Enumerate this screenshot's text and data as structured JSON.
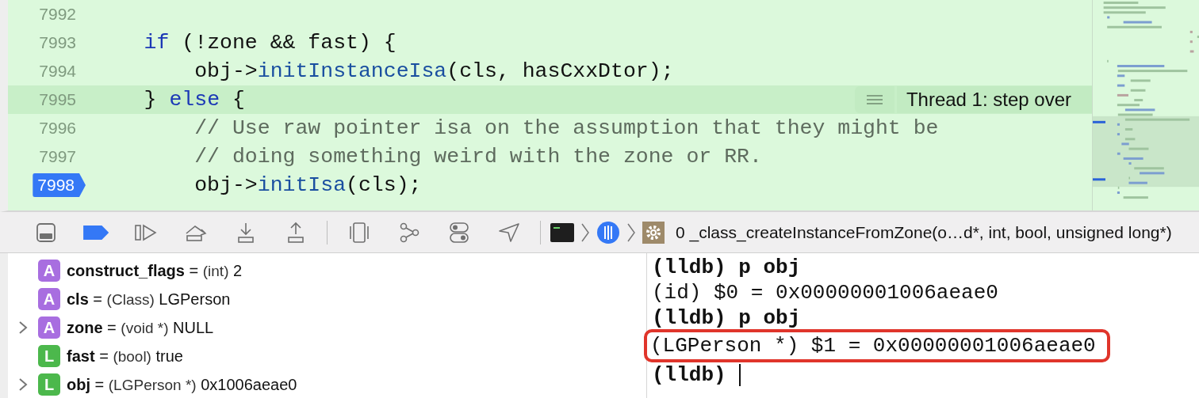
{
  "editor": {
    "lines": [
      {
        "number": "7992",
        "current": false,
        "breakpoint": false
      },
      {
        "number": "7993",
        "current": false,
        "breakpoint": false,
        "tokens": [
          {
            "kind": "keyword",
            "text": "    if"
          },
          {
            "kind": "plain",
            "text": " (!zone && fast) {"
          }
        ]
      },
      {
        "number": "7994",
        "current": false,
        "breakpoint": false,
        "tokens": [
          {
            "kind": "plain",
            "text": "        obj->"
          },
          {
            "kind": "method",
            "text": "initInstanceIsa"
          },
          {
            "kind": "plain",
            "text": "(cls, hasCxxDtor);"
          }
        ]
      },
      {
        "number": "7995",
        "current": true,
        "breakpoint": false,
        "tokens": [
          {
            "kind": "plain",
            "text": "    } "
          },
          {
            "kind": "keyword",
            "text": "else"
          },
          {
            "kind": "plain",
            "text": " {"
          }
        ],
        "annotation": "Thread 1: step over"
      },
      {
        "number": "7996",
        "current": false,
        "breakpoint": false,
        "tokens": [
          {
            "kind": "comment",
            "text": "        // Use raw pointer isa on the assumption that they might be"
          }
        ]
      },
      {
        "number": "7997",
        "current": false,
        "breakpoint": false,
        "tokens": [
          {
            "kind": "comment",
            "text": "        // doing something weird with the zone or RR."
          }
        ]
      },
      {
        "number": "7998",
        "current": false,
        "breakpoint": true,
        "tokens": [
          {
            "kind": "plain",
            "text": "        obj->"
          },
          {
            "kind": "method",
            "text": "initIsa"
          },
          {
            "kind": "plain",
            "text": "(cls);"
          }
        ]
      }
    ]
  },
  "debug_bar": {
    "breakpoints_active": true,
    "frame": "0 _class_createInstanceFromZone(o…d*, int, bool, unsigned long*)"
  },
  "variables": [
    {
      "badge": "A",
      "kind": "argument",
      "expandable": false,
      "name": "construct_flags",
      "assign": "=",
      "type": "(int)",
      "value": "2"
    },
    {
      "badge": "A",
      "kind": "argument",
      "expandable": false,
      "name": "cls",
      "assign": "=",
      "type": "(Class)",
      "value": "LGPerson"
    },
    {
      "badge": "A",
      "kind": "argument",
      "expandable": true,
      "name": "zone",
      "assign": "=",
      "type": "(void *)",
      "value": "NULL"
    },
    {
      "badge": "L",
      "kind": "local",
      "expandable": false,
      "name": "fast",
      "assign": "=",
      "type": "(bool)",
      "value": "true"
    },
    {
      "badge": "L",
      "kind": "local",
      "expandable": true,
      "name": "obj",
      "assign": "=",
      "type": "(LGPerson *)",
      "value": "0x1006aeae0"
    }
  ],
  "console": [
    {
      "kind": "command",
      "text": "(lldb) p obj",
      "highlighted": false,
      "cursor": false
    },
    {
      "kind": "output",
      "text": "(id) $0 = 0x00000001006aeae0",
      "highlighted": false,
      "cursor": false
    },
    {
      "kind": "command",
      "text": "(lldb) p obj",
      "highlighted": false,
      "cursor": false
    },
    {
      "kind": "output",
      "text": "(LGPerson *) $1 = 0x00000001006aeae0",
      "highlighted": true,
      "cursor": false
    },
    {
      "kind": "command",
      "text": "(lldb)",
      "highlighted": false,
      "cursor": true
    }
  ]
}
